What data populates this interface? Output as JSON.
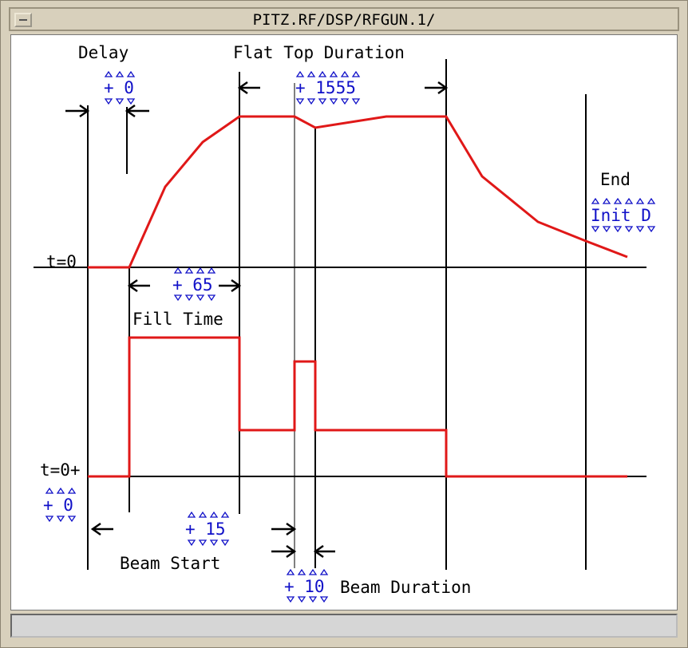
{
  "window": {
    "title": "PITZ.RF/DSP/RFGUN.1/"
  },
  "labels": {
    "delay": "Delay",
    "flat_top_duration": "Flat Top Duration",
    "end": "End",
    "t0": "t=0",
    "t0_plus": "t=0+",
    "fill_time": "Fill Time",
    "beam_start": "Beam Start",
    "beam_duration": "Beam Duration"
  },
  "controls": {
    "delay": "+ 0",
    "flat_top_duration": "+ 1555",
    "fill_time": "+ 65",
    "end": "Init D",
    "t0_plus": "+ 0",
    "beam_start": "+ 15",
    "beam_duration": "+ 10"
  },
  "colors": {
    "waveform": "#e01818",
    "value_text": "#1010c8",
    "background": "#ffffff",
    "frame": "#d8d0bc"
  }
}
